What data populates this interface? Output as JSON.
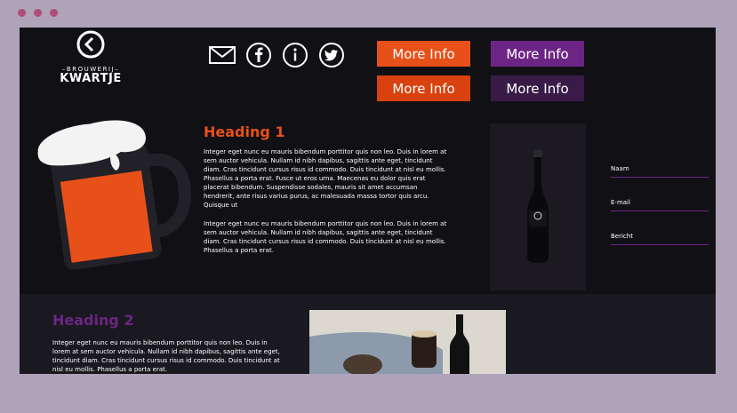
{
  "window": {
    "dots": [
      "red",
      "yellow",
      "green"
    ]
  },
  "brand": {
    "sub": "BROUWERIJ",
    "name": "KWARTJE"
  },
  "social": [
    "mail-icon",
    "facebook-icon",
    "info-icon",
    "twitter-icon"
  ],
  "buttons": {
    "b1": "More Info",
    "b2": "More Info",
    "b3": "More Info",
    "b4": "More Info"
  },
  "hero": {
    "heading": "Heading 1",
    "p1": "Integer eget nunc eu mauris bibendum porttitor quis non leo. Duis in lorem at sem auctor vehicula. Nullam id nibh dapibus, sagittis ante eget, tincidunt diam. Cras tincidunt cursus risus id commodo. Duis tincidunt at nisl eu mollis. Phasellus a porta erat. Fusce ut eros urna. Maecenas eu dolor quis erat placerat bibendum. Suspendisse sodales, mauris sit amet accumsan hendrerit, ante risus varius purus, ac malesuada massa tortor quis arcu. Quisque ut",
    "p2": "Integer eget nunc eu mauris bibendum porttitor quis non leo. Duis in lorem at sem auctor vehicula. Nullam id nibh dapibus, sagittis ante eget, tincidunt diam. Cras tincidunt cursus risus id commodo. Duis tincidunt at nisl eu mollis. Phasellus a porta erat."
  },
  "form": {
    "naam": "Naam",
    "email": "E-mail",
    "bericht": "Bericht"
  },
  "section2": {
    "heading": "Heading 2",
    "p": "Integer eget nunc eu mauris bibendum porttitor quis non leo. Duis in lorem at sem auctor vehicula. Nullam id nibh dapibus, sagittis ante eget, tincidunt diam. Cras tincidunt cursus risus id commodo. Duis tincidunt at nisl eu mollis. Phasellus a porta erat."
  },
  "colors": {
    "orange": "#e8501a",
    "purple": "#6d2585",
    "bg": "#111015"
  }
}
